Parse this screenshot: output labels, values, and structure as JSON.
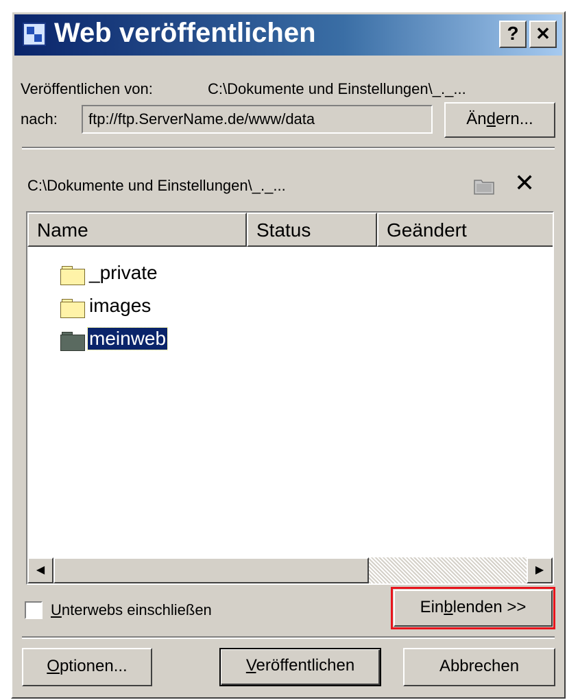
{
  "window": {
    "title": "Web veröffentlichen",
    "help_label": "?",
    "close_label": "✕"
  },
  "publish_from": {
    "label": "Veröffentlichen von:",
    "path": "C:\\Dokumente und Einstellungen\\_._..."
  },
  "publish_to": {
    "label": "nach:",
    "value": "ftp://ftp.ServerName.de/www/data",
    "change_button": "Ändern..."
  },
  "folder_view": {
    "path": "C:\\Dokumente und Einstellungen\\_._...",
    "delete_icon": "✕",
    "columns": [
      "Name",
      "Status",
      "Geändert"
    ],
    "items": [
      {
        "name": "_private",
        "selected": false
      },
      {
        "name": "images",
        "selected": false
      },
      {
        "name": "meinweb",
        "selected": true
      }
    ]
  },
  "subwebs_checkbox": {
    "label": "Unterwebs einschließen",
    "checked": false
  },
  "buttons": {
    "show": "Einblenden >>",
    "options": "Optionen...",
    "publish": "Veröffentlichen",
    "cancel": "Abbrechen"
  },
  "colors": {
    "highlight_border": "#e8141c",
    "selection": "#0a246a"
  }
}
